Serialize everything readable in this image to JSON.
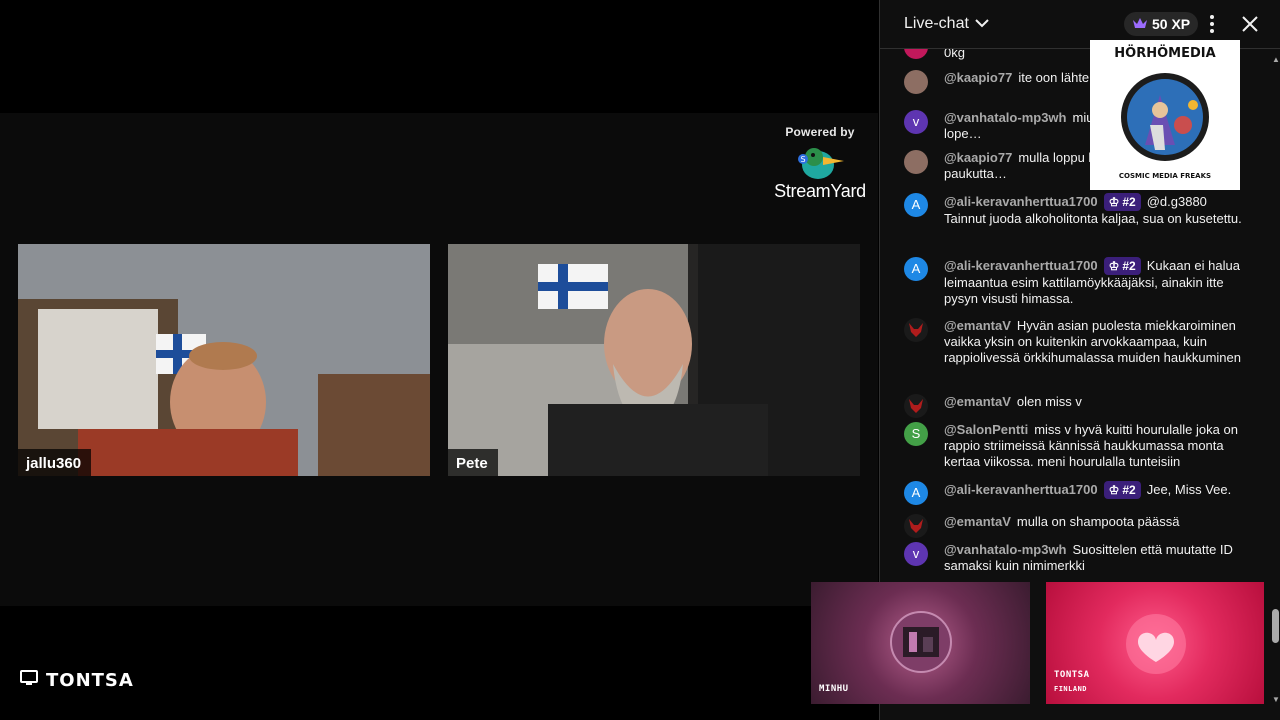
{
  "stream": {
    "powered_by": "Powered by",
    "brand": "StreamYard",
    "participants": [
      {
        "name": "jallu360"
      },
      {
        "name": "Pete"
      }
    ],
    "channel_tag": "TONTSA"
  },
  "chat": {
    "title": "Live-chat",
    "xp": "50 XP",
    "messages": [
      {
        "author": "",
        "text": "0kg",
        "avatar_letter": "",
        "avatar_color": "#c2185b"
      },
      {
        "author": "@kaapio77",
        "text": "ite oon lähter… touhuista pois..",
        "avatar_letter": "",
        "avatar_color": "#8d6e63"
      },
      {
        "author": "@vanhatalo-mp3wh",
        "text": "miu… aina aitoja. Kavonius lope…",
        "avatar_letter": "v",
        "avatar_color": "#5e35b1"
      },
      {
        "author": "@kaapio77",
        "text": "mulla loppu h… huuhtanen rupes paukutta…",
        "avatar_letter": "",
        "avatar_color": "#8d6e63"
      },
      {
        "author": "@ali-keravanherttua1700",
        "badge": "#2",
        "text": "@d.g3880 Tainnut juoda alkoholitonta kaljaa, sua on kusetettu.",
        "avatar_letter": "A",
        "avatar_color": "#1e88e5"
      },
      {
        "author": "@ali-keravanherttua1700",
        "badge": "#2",
        "text": "Kukaan ei halua leimaantua esim kattilamöykkääjäksi, ainakin itte pysyn visusti himassa.",
        "avatar_letter": "A",
        "avatar_color": "#1e88e5"
      },
      {
        "author": "@emantaV",
        "text": "Hyvän asian puolesta miekkaroiminen vaikka yksin on kuitenkin arvokkaampaa, kuin rappiolivessä örkkihumalassa muiden haukkuminen",
        "avatar_letter": "",
        "avatar_color": "#1a1a1a"
      },
      {
        "author": "@emantaV",
        "text": "olen miss v",
        "avatar_letter": "",
        "avatar_color": "#1a1a1a"
      },
      {
        "author": "@SalonPentti",
        "text": "miss v hyvä kuitti hourulalle joka on rappio striimeissä kännissä haukkumassa monta kertaa viikossa. meni hourulalla tunteisiin",
        "avatar_letter": "S",
        "avatar_color": "#43a047"
      },
      {
        "author": "@ali-keravanherttua1700",
        "badge": "#2",
        "text": "Jee, Miss Vee.",
        "avatar_letter": "A",
        "avatar_color": "#1e88e5"
      },
      {
        "author": "@emantaV",
        "text": "mulla on shampoota päässä",
        "avatar_letter": "",
        "avatar_color": "#1a1a1a"
      },
      {
        "author": "@vanhatalo-mp3wh",
        "text": "Suosittelen että muutatte ID samaksi kuin nimimerkki",
        "avatar_letter": "v",
        "avatar_color": "#5e35b1"
      }
    ]
  },
  "overlay": {
    "logo_top": "HÖRHÖMEDIA",
    "logo_bottom": "COSMIC MEDIA FREAKS",
    "tiles": [
      {
        "name": "MINHU",
        "sub": ""
      },
      {
        "name": "TONTSA",
        "sub": "FINLAND"
      }
    ]
  }
}
